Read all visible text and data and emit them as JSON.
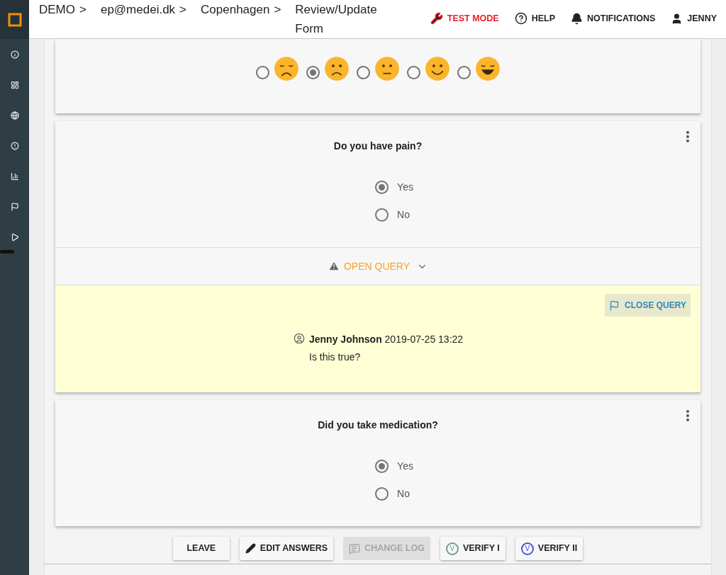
{
  "breadcrumb": {
    "separator": ">",
    "items": [
      "DEMO",
      "ep@medei.dk",
      "Copenhagen",
      "Review/Update Form"
    ]
  },
  "header_actions": [
    {
      "kind": "test",
      "label": "TEST MODE"
    },
    {
      "kind": "help",
      "label": "HELP"
    },
    {
      "kind": "notifications",
      "label": "NOTIFICATIONS"
    },
    {
      "kind": "user",
      "label": "JENNY"
    }
  ],
  "sidebar": {
    "items": [
      {
        "kind": "info"
      },
      {
        "kind": "dashboard"
      },
      {
        "kind": "globe"
      },
      {
        "kind": "alert"
      },
      {
        "kind": "chart"
      },
      {
        "kind": "flag"
      },
      {
        "kind": "play"
      }
    ]
  },
  "mood_question": {
    "options": [
      {
        "kind": "weary",
        "selected": false
      },
      {
        "kind": "frown",
        "selected": true
      },
      {
        "kind": "neutral",
        "selected": false
      },
      {
        "kind": "smile",
        "selected": false
      },
      {
        "kind": "grin",
        "selected": false
      }
    ]
  },
  "questions": [
    {
      "title": "Do you have pain?",
      "options": [
        {
          "label": "Yes",
          "selected": true
        },
        {
          "label": "No",
          "selected": false
        }
      ],
      "query": {
        "label": "OPEN QUERY",
        "close_label": "CLOSE QUERY",
        "author": "Jenny Johnson",
        "time": "2019-07-25 13:22",
        "message": "Is this true?"
      }
    },
    {
      "title": "Did you take medication?",
      "options": [
        {
          "label": "Yes",
          "selected": true
        },
        {
          "label": "No",
          "selected": false
        }
      ]
    }
  ],
  "buttons": [
    {
      "kind": "plain",
      "label": "LEAVE",
      "disabled": false
    },
    {
      "kind": "edit",
      "label": "EDIT ANSWERS",
      "disabled": false
    },
    {
      "kind": "log",
      "label": "CHANGE LOG",
      "disabled": true
    },
    {
      "kind": "verify",
      "badge": "V",
      "color": "#6e9e8c",
      "label": "VERIFY I",
      "disabled": false
    },
    {
      "kind": "verify",
      "badge": "V",
      "color": "#4355d6",
      "label": "VERIFY II",
      "disabled": false
    }
  ]
}
